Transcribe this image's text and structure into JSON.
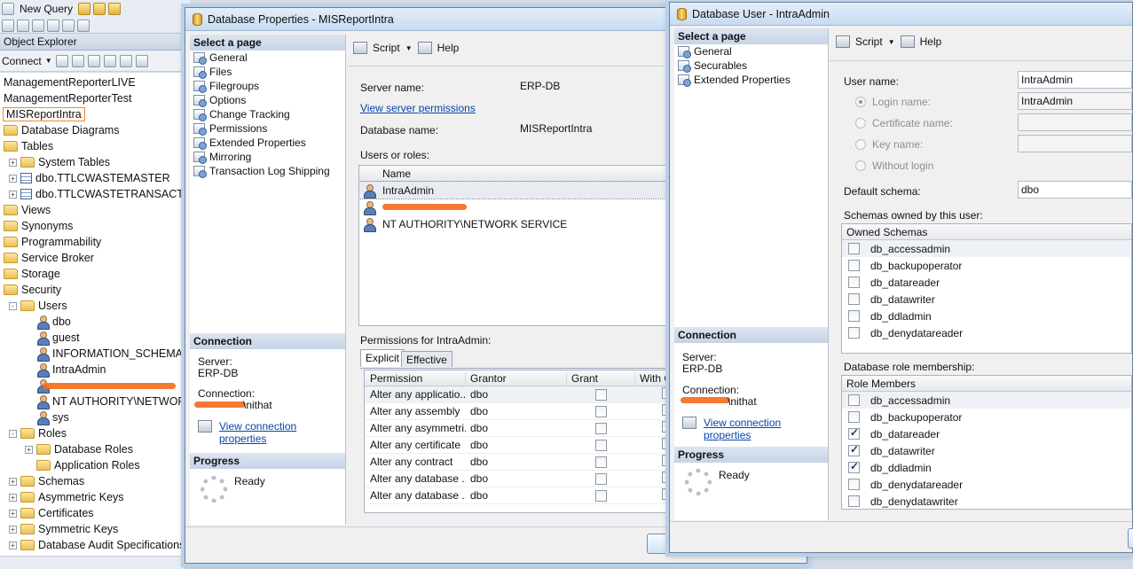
{
  "toolbar": {
    "new_query": "New Query"
  },
  "object_explorer": {
    "title": "Object Explorer",
    "connect_label": "Connect",
    "tree": [
      {
        "label": "ManagementReporterLIVE",
        "indent": 0,
        "icon": "database-icon"
      },
      {
        "label": "ManagementReporterTest",
        "indent": 0,
        "icon": "database-icon"
      },
      {
        "label": "MISReportIntra",
        "indent": 0,
        "icon": "database-icon"
      },
      {
        "label": "Database Diagrams",
        "indent": 1,
        "icon": "folder-icon"
      },
      {
        "label": "Tables",
        "indent": 1,
        "icon": "folder-icon"
      },
      {
        "label": "System Tables",
        "indent": 2,
        "icon": "folder-icon",
        "exp": "+"
      },
      {
        "label": "dbo.TTLCWASTEMASTER",
        "indent": 2,
        "icon": "table-icon",
        "exp": "+"
      },
      {
        "label": "dbo.TTLCWASTETRANSACTION",
        "indent": 2,
        "icon": "table-icon",
        "exp": "+"
      },
      {
        "label": "Views",
        "indent": 1,
        "icon": "folder-icon"
      },
      {
        "label": "Synonyms",
        "indent": 1,
        "icon": "folder-icon"
      },
      {
        "label": "Programmability",
        "indent": 1,
        "icon": "folder-icon"
      },
      {
        "label": "Service Broker",
        "indent": 1,
        "icon": "folder-icon"
      },
      {
        "label": "Storage",
        "indent": 1,
        "icon": "folder-icon"
      },
      {
        "label": "Security",
        "indent": 1,
        "icon": "folder-icon"
      },
      {
        "label": "Users",
        "indent": 2,
        "icon": "folder-icon",
        "exp": "-"
      },
      {
        "label": "dbo",
        "indent": 3,
        "icon": "user-icon"
      },
      {
        "label": "guest",
        "indent": 3,
        "icon": "user-icon"
      },
      {
        "label": "INFORMATION_SCHEMA",
        "indent": 3,
        "icon": "user-icon"
      },
      {
        "label": "IntraAdmin",
        "indent": 3,
        "icon": "user-icon"
      },
      {
        "label": "",
        "indent": 3,
        "icon": "user-icon",
        "redacted": true
      },
      {
        "label": "NT AUTHORITY\\NETWORK SERVICE",
        "indent": 3,
        "icon": "user-icon"
      },
      {
        "label": "sys",
        "indent": 3,
        "icon": "user-icon"
      },
      {
        "label": "Roles",
        "indent": 2,
        "icon": "folder-icon",
        "exp": "-"
      },
      {
        "label": "Database Roles",
        "indent": 3,
        "icon": "folder-icon",
        "exp": "+"
      },
      {
        "label": "Application Roles",
        "indent": 3,
        "icon": "folder-icon"
      },
      {
        "label": "Schemas",
        "indent": 2,
        "icon": "folder-icon",
        "exp": "+"
      },
      {
        "label": "Asymmetric Keys",
        "indent": 2,
        "icon": "folder-icon",
        "exp": "+"
      },
      {
        "label": "Certificates",
        "indent": 2,
        "icon": "folder-icon",
        "exp": "+"
      },
      {
        "label": "Symmetric Keys",
        "indent": 2,
        "icon": "folder-icon",
        "exp": "+"
      },
      {
        "label": "Database Audit Specifications",
        "indent": 2,
        "icon": "folder-icon",
        "exp": "+"
      }
    ]
  },
  "db_properties": {
    "title": "Database Properties - MISReportIntra",
    "select_page": "Select a page",
    "pages": [
      "General",
      "Files",
      "Filegroups",
      "Options",
      "Change Tracking",
      "Permissions",
      "Extended Properties",
      "Mirroring",
      "Transaction Log Shipping"
    ],
    "script_label": "Script",
    "help_label": "Help",
    "server_name_label": "Server name:",
    "server_name_value": "ERP-DB",
    "view_server_permissions": "View server permissions",
    "database_name_label": "Database name:",
    "database_name_value": "MISReportIntra",
    "users_or_roles_label": "Users or roles:",
    "users_grid_header": "Name",
    "users": [
      "IntraAdmin",
      "",
      "NT AUTHORITY\\NETWORK SERVICE"
    ],
    "permissions_for_label": "Permissions for IntraAdmin:",
    "tab_explicit": "Explicit",
    "tab_effective": "Effective",
    "perm_headers": [
      "Permission",
      "Grantor",
      "Grant",
      "With G"
    ],
    "permissions": [
      {
        "permission": "Alter any applicatio...",
        "grantor": "dbo"
      },
      {
        "permission": "Alter any assembly",
        "grantor": "dbo"
      },
      {
        "permission": "Alter any asymmetri...",
        "grantor": "dbo"
      },
      {
        "permission": "Alter any certificate",
        "grantor": "dbo"
      },
      {
        "permission": "Alter any contract",
        "grantor": "dbo"
      },
      {
        "permission": "Alter any database ...",
        "grantor": "dbo"
      },
      {
        "permission": "Alter any database ...",
        "grantor": "dbo"
      }
    ],
    "connection_head": "Connection",
    "server_label": "Server:",
    "server_value": "ERP-DB",
    "connection_label": "Connection:",
    "connection_value_suffix": "\\nithat",
    "view_connection_properties": "View connection properties",
    "progress_head": "Progress",
    "progress_status": "Ready"
  },
  "db_user": {
    "title": "Database User - IntraAdmin",
    "select_page": "Select a page",
    "pages": [
      "General",
      "Securables",
      "Extended Properties"
    ],
    "script_label": "Script",
    "help_label": "Help",
    "user_name_label": "User name:",
    "user_name_value": "IntraAdmin",
    "login_name_label": "Login name:",
    "login_name_value": "IntraAdmin",
    "certificate_name_label": "Certificate name:",
    "key_name_label": "Key name:",
    "without_login_label": "Without login",
    "default_schema_label": "Default schema:",
    "default_schema_value": "dbo",
    "schemas_owned_label": "Schemas owned by this user:",
    "owned_schemas_header": "Owned Schemas",
    "owned_schemas": [
      {
        "name": "db_accessadmin",
        "checked": false
      },
      {
        "name": "db_backupoperator",
        "checked": false
      },
      {
        "name": "db_datareader",
        "checked": false
      },
      {
        "name": "db_datawriter",
        "checked": false
      },
      {
        "name": "db_ddladmin",
        "checked": false
      },
      {
        "name": "db_denydatareader",
        "checked": false
      }
    ],
    "role_membership_label": "Database role membership:",
    "role_members_header": "Role Members",
    "role_members": [
      {
        "name": "db_accessadmin",
        "checked": false
      },
      {
        "name": "db_backupoperator",
        "checked": false
      },
      {
        "name": "db_datareader",
        "checked": true
      },
      {
        "name": "db_datawriter",
        "checked": true
      },
      {
        "name": "db_ddladmin",
        "checked": true
      },
      {
        "name": "db_denydatareader",
        "checked": false
      },
      {
        "name": "db_denydatawriter",
        "checked": false
      }
    ],
    "connection_head": "Connection",
    "server_label": "Server:",
    "server_value": "ERP-DB",
    "connection_label": "Connection:",
    "connection_value_suffix": "\\nithat",
    "view_connection_properties": "View connection properties",
    "progress_head": "Progress",
    "progress_status": "Ready"
  }
}
